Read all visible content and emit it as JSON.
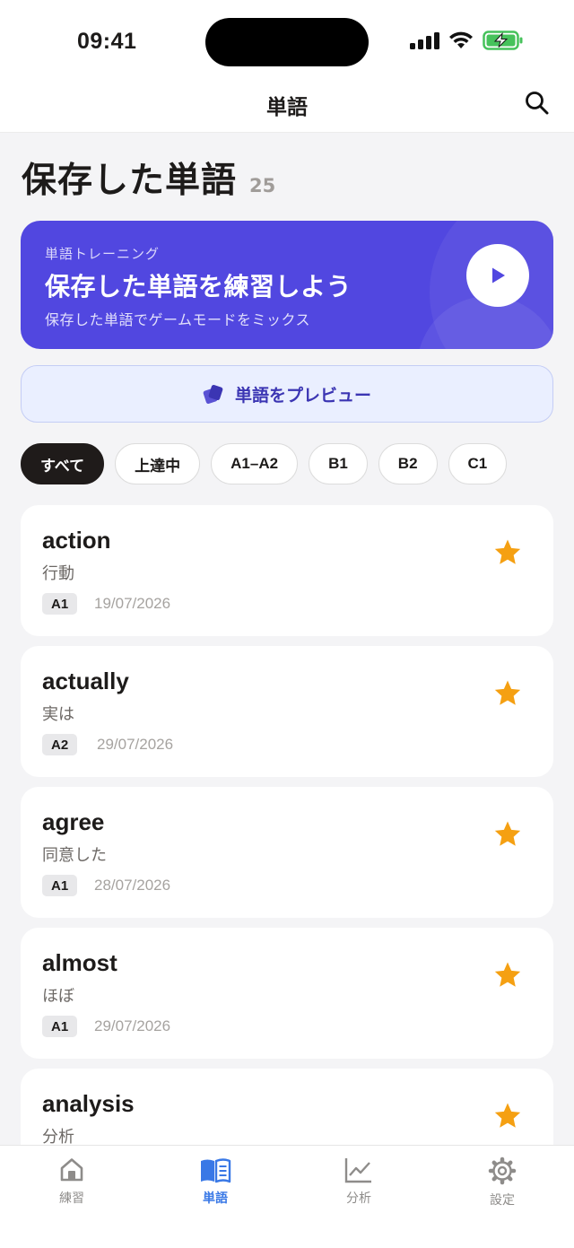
{
  "status_bar": {
    "time": "09:41"
  },
  "nav": {
    "title": "単語"
  },
  "page": {
    "title": "保存した単語",
    "count": "25"
  },
  "training": {
    "eyebrow": "単語トレーニング",
    "title": "保存した単語を練習しよう",
    "subtitle": "保存した単語でゲームモードをミックス"
  },
  "preview": {
    "label": "単語をプレビュー"
  },
  "filters": [
    {
      "label": "すべて",
      "active": true
    },
    {
      "label": "上達中",
      "active": false
    },
    {
      "label": "A1–A2",
      "active": false
    },
    {
      "label": "B1",
      "active": false
    },
    {
      "label": "B2",
      "active": false
    },
    {
      "label": "C1",
      "active": false
    }
  ],
  "words": [
    {
      "word": "action",
      "meaning": "行動",
      "level": "A1",
      "date": "19/07/2026",
      "starred": true
    },
    {
      "word": "actually",
      "meaning": "実は",
      "level": "A2",
      "date": "29/07/2026",
      "starred": true
    },
    {
      "word": "agree",
      "meaning": "同意した",
      "level": "A1",
      "date": "28/07/2026",
      "starred": true
    },
    {
      "word": "almost",
      "meaning": "ほぼ",
      "level": "A1",
      "date": "29/07/2026",
      "starred": true
    },
    {
      "word": "analysis",
      "meaning": "分析",
      "level": "",
      "date": "",
      "starred": true
    }
  ],
  "tabs": [
    {
      "label": "練習",
      "icon": "home-icon",
      "active": false
    },
    {
      "label": "単語",
      "icon": "book-icon",
      "active": true
    },
    {
      "label": "分析",
      "icon": "chart-icon",
      "active": false
    },
    {
      "label": "設定",
      "icon": "gear-icon",
      "active": false
    }
  ],
  "colors": {
    "accent": "#5147e0",
    "tab_active": "#3978e6",
    "star": "#f5a012",
    "chip_active": "#1f1b1a",
    "battery": "#46c25b"
  }
}
